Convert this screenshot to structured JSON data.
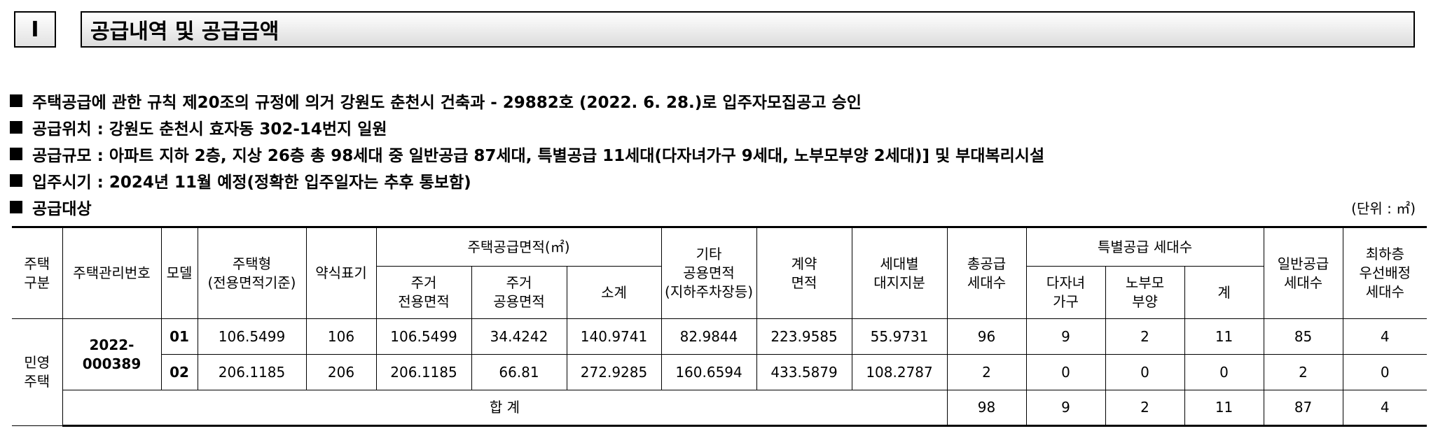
{
  "header": {
    "number": "I",
    "title": "공급내역 및 공급금액"
  },
  "bullets": [
    "주택공급에 관한 규칙 제20조의 규정에 의거 강원도 춘천시 건축과 - 29882호 (2022. 6. 28.)로 입주자모집공고 승인",
    "공급위치 : 강원도 춘천시 효자동 302-14번지 일원",
    "공급규모 : 아파트 지하 2층, 지상 26층 총 98세대 중 일반공급 87세대, 특별공급 11세대(다자녀가구 9세대, 노부모부양 2세대)] 및 부대복리시설",
    "입주시기 : 2024년 11월 예정(정확한 입주일자는 추후 통보함)",
    "공급대상"
  ],
  "unit": "(단위 : ㎡)",
  "table": {
    "headers": {
      "housing_type_l1": "주택",
      "housing_type_l2": "구분",
      "mgmt_no": "주택관리번호",
      "model": "모델",
      "type_l1": "주택형",
      "type_l2": "(전용면적기준)",
      "abbrev": "약식표기",
      "supply_area": "주택공급면적(㎡)",
      "excl_l1": "주거",
      "excl_l2": "전용면적",
      "common_l1": "주거",
      "common_l2": "공용면적",
      "subtotal": "소계",
      "other_l1": "기타",
      "other_l2": "공용면적",
      "other_l3": "(지하주차장등)",
      "contract_l1": "계약",
      "contract_l2": "면적",
      "land_l1": "세대별",
      "land_l2": "대지지분",
      "total_l1": "총공급",
      "total_l2": "세대수",
      "special": "특별공급 세대수",
      "multi_l1": "다자녀",
      "multi_l2": "가구",
      "elder_l1": "노부모",
      "elder_l2": "부양",
      "special_sum": "계",
      "general_l1": "일반공급",
      "general_l2": "세대수",
      "lowest_l1": "최하층",
      "lowest_l2": "우선배정",
      "lowest_l3": "세대수"
    },
    "category_l1": "민영",
    "category_l2": "주택",
    "mgmt_no": "2022-000389",
    "rows": [
      {
        "model": "01",
        "type": "106.5499",
        "abbrev": "106",
        "excl": "106.5499",
        "common": "34.4242",
        "subtotal": "140.9741",
        "other": "82.9844",
        "contract": "223.9585",
        "land": "55.9731",
        "total": "96",
        "multi": "9",
        "elder": "2",
        "special_sum": "11",
        "general": "85",
        "lowest": "4"
      },
      {
        "model": "02",
        "type": "206.1185",
        "abbrev": "206",
        "excl": "206.1185",
        "common": "66.81",
        "subtotal": "272.9285",
        "other": "160.6594",
        "contract": "433.5879",
        "land": "108.2787",
        "total": "2",
        "multi": "0",
        "elder": "0",
        "special_sum": "0",
        "general": "2",
        "lowest": "0"
      }
    ],
    "sum": {
      "label": "합 계",
      "total": "98",
      "multi": "9",
      "elder": "2",
      "special_sum": "11",
      "general": "87",
      "lowest": "4"
    }
  }
}
